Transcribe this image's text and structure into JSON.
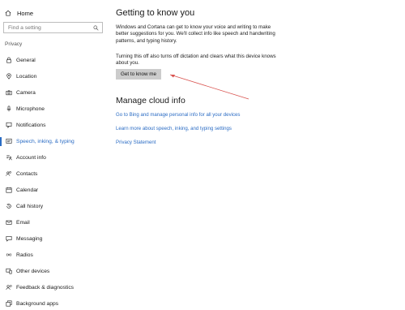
{
  "sidebar": {
    "home_label": "Home",
    "search_placeholder": "Find a setting",
    "section_label": "Privacy",
    "items": [
      {
        "label": "General",
        "icon": "lock-icon"
      },
      {
        "label": "Location",
        "icon": "location-icon"
      },
      {
        "label": "Camera",
        "icon": "camera-icon"
      },
      {
        "label": "Microphone",
        "icon": "microphone-icon"
      },
      {
        "label": "Notifications",
        "icon": "notifications-icon"
      },
      {
        "label": "Speech, inking, & typing",
        "icon": "speech-icon",
        "active": true
      },
      {
        "label": "Account info",
        "icon": "account-icon"
      },
      {
        "label": "Contacts",
        "icon": "contacts-icon"
      },
      {
        "label": "Calendar",
        "icon": "calendar-icon"
      },
      {
        "label": "Call history",
        "icon": "history-icon"
      },
      {
        "label": "Email",
        "icon": "email-icon"
      },
      {
        "label": "Messaging",
        "icon": "messaging-icon"
      },
      {
        "label": "Radios",
        "icon": "radios-icon"
      },
      {
        "label": "Other devices",
        "icon": "devices-icon"
      },
      {
        "label": "Feedback & diagnostics",
        "icon": "feedback-icon"
      },
      {
        "label": "Background apps",
        "icon": "background-apps-icon"
      }
    ]
  },
  "main": {
    "title": "Getting to know you",
    "paragraph1": "Windows and Cortana can get to know your voice and writing to make better suggestions for you. We'll collect info like speech and handwriting patterns, and typing history.",
    "paragraph2": "Turning this off also turns off dictation and clears what this device knows about you.",
    "button_label": "Get to know me",
    "cloud_title": "Manage cloud info",
    "links": [
      "Go to Bing and manage personal info for all your devices",
      "Learn more about speech, inking, and typing settings",
      "Privacy Statement"
    ]
  },
  "colors": {
    "accent": "#2b6cc4",
    "button_bg": "#cccccc",
    "annotation": "#d9534f"
  }
}
